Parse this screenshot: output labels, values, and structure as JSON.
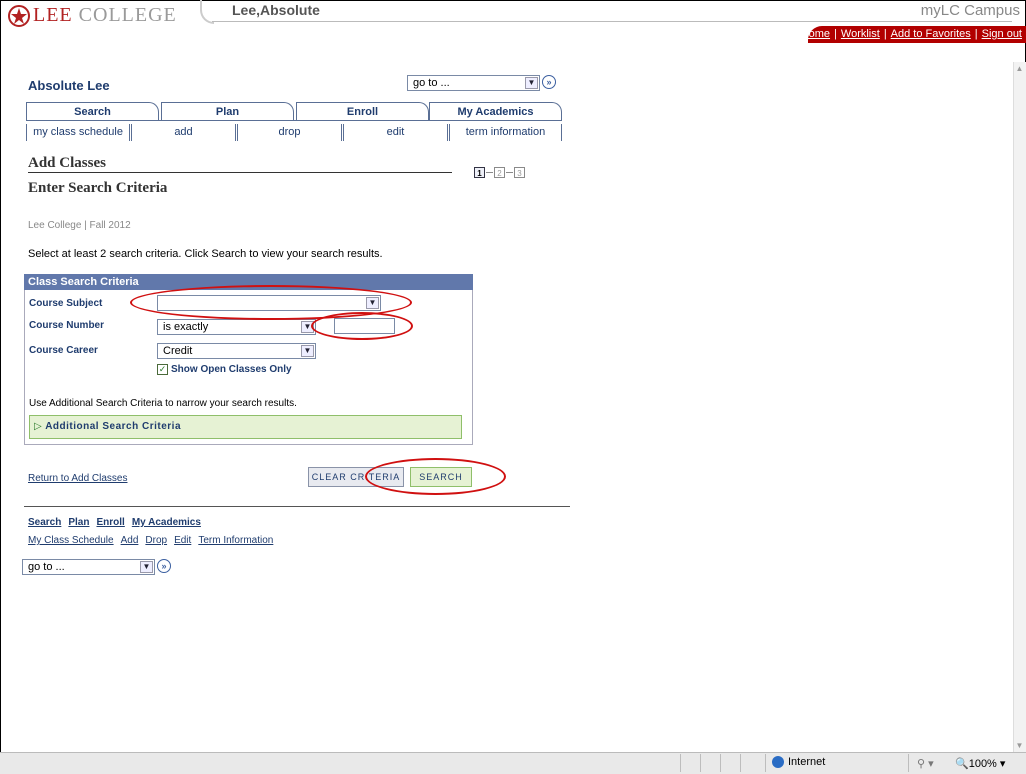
{
  "header": {
    "logo_text_first": "LEE",
    "logo_text_rest": " COLLEGE",
    "user_name": "Lee,Absolute",
    "campus_title": "myLC Campus",
    "links": [
      "Home",
      "Worklist",
      "Add to Favorites",
      "Sign out"
    ]
  },
  "student": {
    "name": "Absolute Lee"
  },
  "goto": {
    "value": "go to ..."
  },
  "tabs": [
    "Search",
    "Plan",
    "Enroll",
    "My Academics"
  ],
  "subtabs": [
    "my class schedule",
    "add",
    "drop",
    "edit",
    "term information"
  ],
  "page": {
    "title": "Add Classes",
    "subtitle": "Enter Search Criteria",
    "steps": [
      "1",
      "2",
      "3"
    ],
    "context": "Lee College | Fall 2012",
    "instructions": "Select at least 2 search criteria. Click Search to view your search results."
  },
  "criteria": {
    "header": "Class Search Criteria",
    "course_subject_label": "Course Subject",
    "course_subject_value": "",
    "course_number_label": "Course Number",
    "course_number_operator": "is exactly",
    "course_number_value": "",
    "course_career_label": "Course Career",
    "course_career_value": "Credit",
    "show_open_label": "Show Open Classes Only",
    "show_open_checked": true,
    "additional_note": "Use Additional Search Criteria to narrow your search results.",
    "additional_label": "Additional Search Criteria"
  },
  "actions": {
    "return_link": "Return to Add Classes",
    "clear_button": "CLEAR CRITERIA",
    "search_button": "SEARCH"
  },
  "footer_links": {
    "primary": [
      "Search",
      "Plan",
      "Enroll",
      "My Academics"
    ],
    "secondary": [
      "My Class Schedule",
      "Add",
      "Drop",
      "Edit",
      "Term Information"
    ]
  },
  "statusbar": {
    "zone": "Internet",
    "zoom": "100%"
  },
  "colors": {
    "brand_red": "#b20000",
    "nav_blue": "#1f3c6e",
    "header_blue": "#6178ab",
    "annotation_red": "#d01010"
  }
}
